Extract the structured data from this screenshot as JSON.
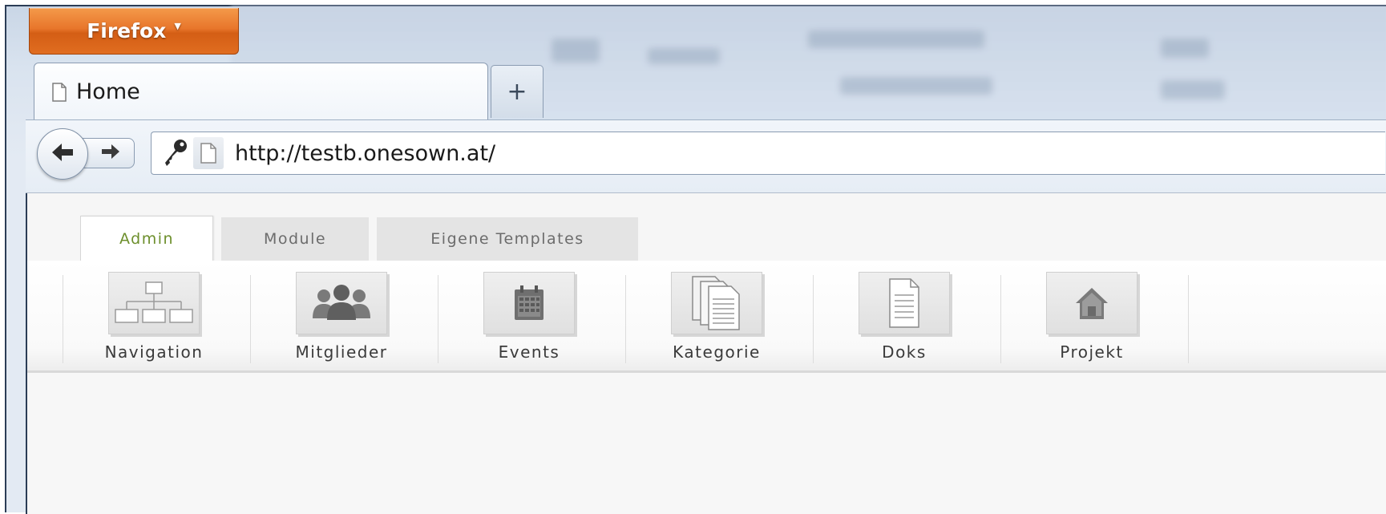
{
  "browser": {
    "menu_button_label": "Firefox",
    "tab_title": "Home",
    "new_tab_label": "+",
    "url": "http://testb.onesown.at/"
  },
  "app": {
    "tabs": [
      {
        "label": "Admin",
        "active": true
      },
      {
        "label": "Module",
        "active": false
      },
      {
        "label": "Eigene Templates",
        "active": false
      }
    ],
    "toolbar": [
      {
        "label": "Navigation",
        "icon": "sitemap-icon"
      },
      {
        "label": "Mitglieder",
        "icon": "users-icon"
      },
      {
        "label": "Events",
        "icon": "calendar-icon"
      },
      {
        "label": "Kategorie",
        "icon": "documents-icon"
      },
      {
        "label": "Doks",
        "icon": "document-icon"
      },
      {
        "label": "Projekt",
        "icon": "home-icon"
      }
    ]
  },
  "colors": {
    "firefox_orange": "#e8762b",
    "active_tab_text": "#6d8f2c",
    "icon_gray": "#6f6f6f"
  }
}
